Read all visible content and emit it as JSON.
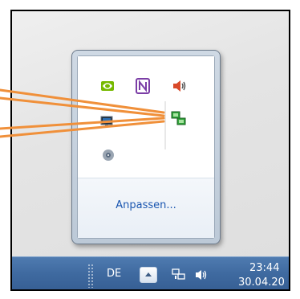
{
  "popup": {
    "customize_label": "Anpassen...",
    "icons": [
      {
        "name": "nvidia-icon",
        "color": "#76b900"
      },
      {
        "name": "onenote-icon",
        "label": "N",
        "color": "#7b3ea6"
      },
      {
        "name": "speaker-icon",
        "color": "#d94a2a"
      },
      {
        "name": "display-monitor-icon",
        "color": "#2c6fb4"
      },
      {
        "name": "network-computers-icon",
        "color": "#2fa43a"
      },
      {
        "name": "media-disc-icon",
        "color": "#5a6b80"
      }
    ]
  },
  "taskbar": {
    "language": "DE",
    "show_hidden_icon": "chevron-up-icon",
    "network_icon": "network-icon",
    "volume_icon": "volume-icon",
    "time": "23:44",
    "date": "30.04.20"
  },
  "annotation": {
    "color": "#f0903a"
  }
}
